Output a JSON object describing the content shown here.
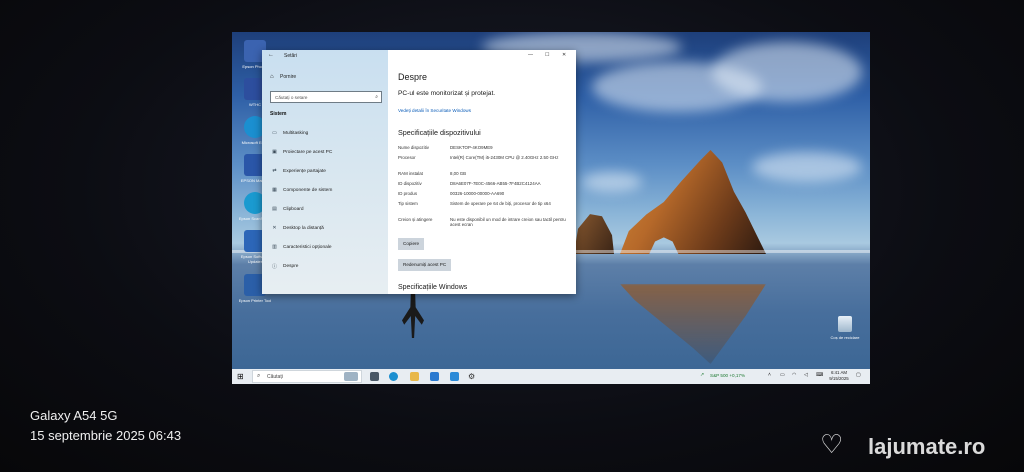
{
  "photo": {
    "device": "Galaxy A54 5G",
    "date": "15 septembrie 2025 06:43",
    "watermark": "lajumate.ro"
  },
  "desktop": {
    "icons": [
      {
        "label": "Epson Photo+",
        "color": "#3b63b0"
      },
      {
        "label": "WTHC",
        "color": "#2d4e9e"
      },
      {
        "label": "Microsoft Edge",
        "color": "#1b8fd0"
      },
      {
        "label": "EPSON Manual",
        "color": "#2a56a8"
      },
      {
        "label": "Epson ScanSmart",
        "color": "#1a9ad0"
      },
      {
        "label": "Epson Software Updater",
        "color": "#2c66b8"
      },
      {
        "label": "Epson Printer Tool",
        "color": "#2b5fa8"
      }
    ],
    "recycle_bin": "Coș de reciclare"
  },
  "settings": {
    "window_title": "Setări",
    "nav": {
      "home": "Pornire",
      "search_placeholder": "Căutați o setare",
      "section": "Sistem",
      "items": [
        {
          "label": "Multitasking",
          "icon": "multitasking-icon",
          "glyph": "▭"
        },
        {
          "label": "Proiectare pe acest PC",
          "icon": "projecting-icon",
          "glyph": "▣"
        },
        {
          "label": "Experiențe partajate",
          "icon": "shared-experiences-icon",
          "glyph": "⇄"
        },
        {
          "label": "Componente de sistem",
          "icon": "system-components-icon",
          "glyph": "▦"
        },
        {
          "label": "Clipboard",
          "icon": "clipboard-icon",
          "glyph": "▤"
        },
        {
          "label": "Desktop la distanță",
          "icon": "remote-desktop-icon",
          "glyph": "✕"
        },
        {
          "label": "Caracteristici opționale",
          "icon": "optional-features-icon",
          "glyph": "▥"
        },
        {
          "label": "Despre",
          "icon": "info-icon",
          "glyph": "ⓘ"
        }
      ]
    },
    "main": {
      "title": "Despre",
      "protected": "PC-ul este monitorizat și protejat.",
      "security_link": "Vedeți detalii în Securitate Windows",
      "specs_title": "Specificațiile dispozitivului",
      "specs": [
        {
          "key": "Nume dispozitiv",
          "value": "DESKTOP-4KO9ME9"
        },
        {
          "key": "Procesor",
          "value": "Intel(R) Core(TM) i5-2430M CPU @ 2.40GHz 2.50 GHz"
        },
        {
          "key": "RAM instalat",
          "value": "8,00 GB"
        },
        {
          "key": "ID dispozitiv",
          "value": "D8A6E07F-7E0C-4566-AB55-7F4B2C4124AA"
        },
        {
          "key": "ID produs",
          "value": "00326-10000-00000-AA690"
        },
        {
          "key": "Tip sistem",
          "value": "Sistem de operare pe 64 de biți, procesor de tip x64"
        },
        {
          "key": "Creion și atingere",
          "value": "Nu este disponibil un mod de intrare creion sau tactil pentru acest ecran"
        }
      ],
      "copy_button": "Copiere",
      "rename_button": "Redenumiți acest PC",
      "windows_specs_title": "Specificațiile Windows"
    }
  },
  "taskbar": {
    "search_placeholder": "Căutați",
    "ticker": "S&P 500  +0,17%",
    "clock_time": "6:41 AM",
    "clock_date": "9/15/2025"
  }
}
